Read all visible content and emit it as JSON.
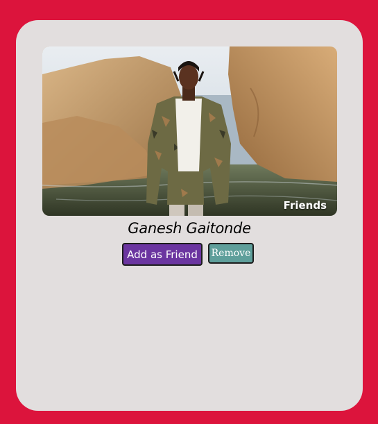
{
  "profile": {
    "name": "Ganesh Gaitonde",
    "badge": "Friends",
    "photo_alt": "Ganesh Gaitonde"
  },
  "actions": {
    "add_label": "Add as Friend",
    "remove_label": "Remove"
  },
  "colors": {
    "page_background": "#dc143c",
    "card_background": "#e2dede",
    "add_button": "#6b35a0",
    "remove_button": "#5f9f9b"
  }
}
